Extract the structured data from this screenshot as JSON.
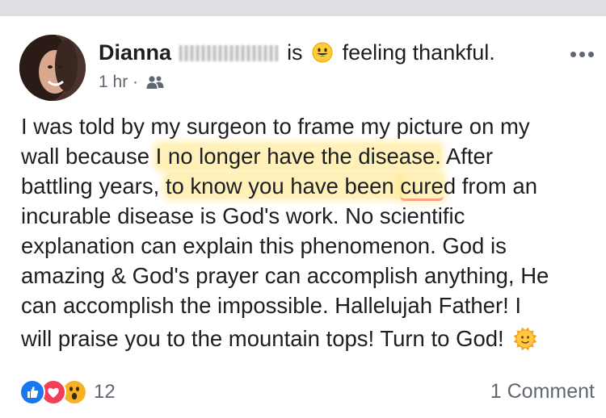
{
  "post": {
    "author_first": "Dianna",
    "author_redacted": "",
    "action_prefix": "is",
    "activity_emoji": "smiling-face-icon",
    "activity": "feeling thankful.",
    "time": "1 hr",
    "separator": "·",
    "audience_icon": "friends-icon",
    "more_icon": "more-options-icon",
    "body_lines": [
      {
        "segments": [
          {
            "text": "I was told by my surgeon to frame my picture on my",
            "style": "plain"
          }
        ]
      },
      {
        "segments": [
          {
            "text": "wall because ",
            "style": "plain"
          },
          {
            "text": "I no longer have the disease.",
            "style": "highlight"
          },
          {
            "text": " After",
            "style": "plain"
          }
        ]
      },
      {
        "segments": [
          {
            "text": "battling years, ",
            "style": "plain"
          },
          {
            "text": "to know you have been ",
            "style": "highlight"
          },
          {
            "text": "cure",
            "style": "highlight-underline"
          },
          {
            "text": "d from an",
            "style": "plain"
          }
        ]
      },
      {
        "segments": [
          {
            "text": "incurable disease is God's work. No scientific",
            "style": "plain"
          }
        ]
      },
      {
        "segments": [
          {
            "text": "explanation can explain this phenomenon. God is",
            "style": "plain"
          }
        ]
      },
      {
        "segments": [
          {
            "text": "amazing & God's prayer can accomplish anything, He",
            "style": "plain"
          }
        ]
      },
      {
        "segments": [
          {
            "text": "can accomplish the impossible. Hallelujah Father!  I",
            "style": "plain"
          }
        ]
      },
      {
        "segments": [
          {
            "text": "will praise you to the mountain tops! Turn to God!",
            "style": "plain"
          }
        ]
      }
    ],
    "end_emoji": "sun-icon",
    "reactions": {
      "icons": [
        "like-icon",
        "love-icon",
        "wow-icon"
      ],
      "count": "12"
    },
    "comments_label": "1 Comment",
    "colors": {
      "like": "#1877f2",
      "love": "#f33e58",
      "wow": "#f7b125",
      "highlight": "#ffdd57",
      "meta": "#606770"
    }
  }
}
